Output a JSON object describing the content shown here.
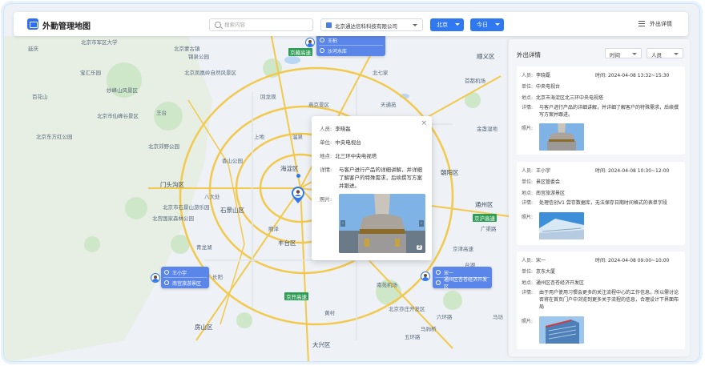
{
  "app": {
    "title": "外勤管理地图"
  },
  "header": {
    "search_placeholder": "搜索内容",
    "company": "北京通达信科科技有限公司",
    "city": "北京",
    "date_range": "今日",
    "detail_link": "外出详情"
  },
  "map": {
    "places": {
      "p1": "北京市军区大学",
      "p2": "北京蒙古镇",
      "p3": "锦泉公园",
      "p4": "妙峰山风景区",
      "p5": "北京凤凰岭自然风景区",
      "p6": "宝汇乐园",
      "p7": "北京市仙峰谷景区",
      "p8": "王台",
      "p9": "北京东方红公园",
      "p10": "百花山",
      "p11": "北京市",
      "p12": "东区",
      "p13": "东城区",
      "p14": "天安门",
      "p15": "北京动物园",
      "p16": "海淀区",
      "p17": "门头沟区",
      "p18": "石景山区",
      "p19": "丰台区",
      "p20": "房山区",
      "p21": "大兴区",
      "p22": "通州区",
      "p23": "朝阳区",
      "p24": "西城区",
      "p25": "北京市石景山游乐园",
      "p26": "燕京景区",
      "p27": "北宫国家森林公园",
      "p28": "北京郊野公园",
      "p29": "首都机场",
      "p30": "顺义区",
      "p31": "南苑机场",
      "p32": "北京亦庄开发区",
      "p33": "金盏湿地",
      "p34": "广渠路",
      "p35": "京津高速",
      "p36": "六环路",
      "p37": "五环路",
      "p38": "温泉",
      "p39": "北七家",
      "p40": "天通苑",
      "p41": "回龙观",
      "p42": "上地",
      "p43": "香山公园",
      "p44": "八大处",
      "p45": "丽泽",
      "p46": "青龙湖",
      "p47": "长阳",
      "p48": "黄村",
      "p49": "马驹桥",
      "p50": "台湖",
      "p51": "马坊",
      "p52": "延庆"
    },
    "roads": [
      "京藏高速",
      "京开高速",
      "京沪高速"
    ],
    "markers": {
      "north": {
        "name": "王柏",
        "place": "沙河水库"
      },
      "west": {
        "name": "王小宇",
        "place": "南宫旅游景区"
      },
      "east": {
        "name": "宋一",
        "place": "通州区杏苍经济开发区"
      }
    }
  },
  "popup": {
    "labels": {
      "person": "人员:",
      "unit": "单位:",
      "place": "地点:",
      "detail": "详情:",
      "photo": "照片:"
    },
    "person": "李晓磊",
    "unit": "中央电视台",
    "place": "北三环中央电视塔",
    "detail": "与客户进行产品的详细讲解，并详细了解客户的特殊需求，后续撰写方案并跟进。",
    "photo_count": "2",
    "close": "×"
  },
  "panel": {
    "title": "外出详情",
    "filter_time": "时间",
    "filter_person": "人员",
    "labels": {
      "person": "人员:",
      "time": "时间:",
      "unit": "单位:",
      "place": "地点:",
      "detail": "详情:",
      "photo": "照片:"
    },
    "records": [
      {
        "person": "李晓磊",
        "time": "2024-04-08 13:32~15:30",
        "unit": "中央电视台",
        "place": "北京市海淀区北三环中央电视塔",
        "detail": "与客户进行产品的详细讲解，并详细了解客户的特殊需求，后续撰写方案并跟进。"
      },
      {
        "person": "王小宇",
        "time": "2024-04-08 10:30~12:00",
        "unit": "景区管委会",
        "place": "南宫旅游景区",
        "detail": "处理信创V1 尝存数据库，无法保存日期时间格式的表单字段"
      },
      {
        "person": "宋一",
        "time": "2024-04-08 09:00~10:00",
        "unit": "京东大厦",
        "place": "通州区杏苍经济开发区",
        "detail": "由于用户使用习惯会更多的关注流程中心的工作信息，所以需讨论否将在首页门户中浏览到更多关于流程的信息，合理设计下界面布局"
      }
    ]
  },
  "colors": {
    "accent": "#2f78ef",
    "marker": "#5b86e9",
    "park": "#2e9d55"
  }
}
